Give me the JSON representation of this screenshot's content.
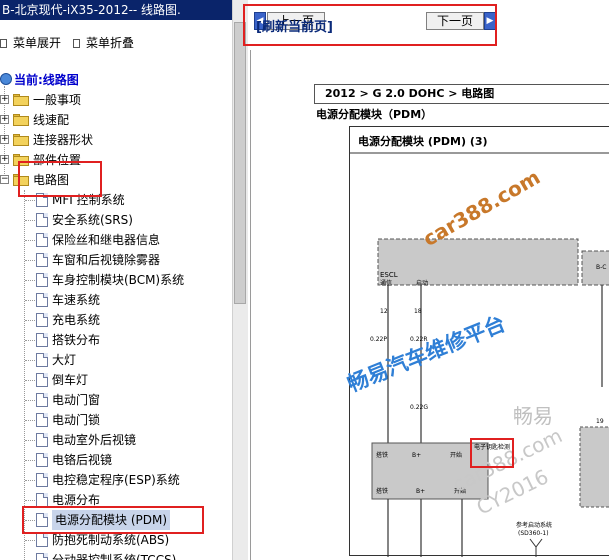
{
  "window": {
    "title": "B-北京现代-iX35-2012-- 线路图."
  },
  "menu": {
    "expand": "菜单展开",
    "collapse": "菜单折叠"
  },
  "tree": {
    "current": "当前:线路图",
    "folders": [
      "一般事项",
      "线速配",
      "连接器形状",
      "部件位置",
      "电路图"
    ],
    "items": [
      "MFI 控制系统",
      "安全系统(SRS)",
      "保险丝和继电器信息",
      "车窗和后视镜除雾器",
      "车身控制模块(BCM)系统",
      "车速系统",
      "充电系统",
      "搭铁分布",
      "大灯",
      "倒车灯",
      "电动门窗",
      "电动门锁",
      "电动室外后视镜",
      "电铬后视镜",
      "电控稳定程序(ESP)系统",
      "电源分布",
      "电源分配模块 (PDM)",
      "防抱死制动系统(ABS)",
      "分动器控制系统(TCCS)"
    ]
  },
  "nav": {
    "prev": "上一页",
    "next": "下一页",
    "refresh": "[刷新当前页]"
  },
  "content": {
    "breadcrumb": "2012 > G 2.0 DOHC > 电路图",
    "section_title": "电源分配模块（PDM）",
    "diagram_title": "电源分配模块 (PDM) (3)",
    "labels": {
      "escl": "ESCL",
      "signal": "通信",
      "start": "启动",
      "bc": "B-C",
      "pin12": "12",
      "pin18": "18",
      "w022p": "0.22P",
      "w022r": "0.22R",
      "w022g": "0.22G",
      "gnd": "搭铁",
      "bplus": "B+",
      "start2": "开始",
      "ref": "参考启动系统",
      "refcode": "(SD360-1)",
      "pin19": "19",
      "hot": "电子钥匙检测",
      "pin3": "3",
      "pin5": "5",
      "pin1": "1"
    }
  },
  "watermarks": {
    "w1": "car388.com",
    "w2": "畅易汽车维修平台",
    "w3": "畅易",
    "w4": "car388.com",
    "w5": "CY2016"
  },
  "colors": {
    "titlebar": "#0a246a",
    "highlight": "#e02020",
    "watermark_orange": "#c8782a",
    "watermark_blue": "#2f7fd6"
  }
}
